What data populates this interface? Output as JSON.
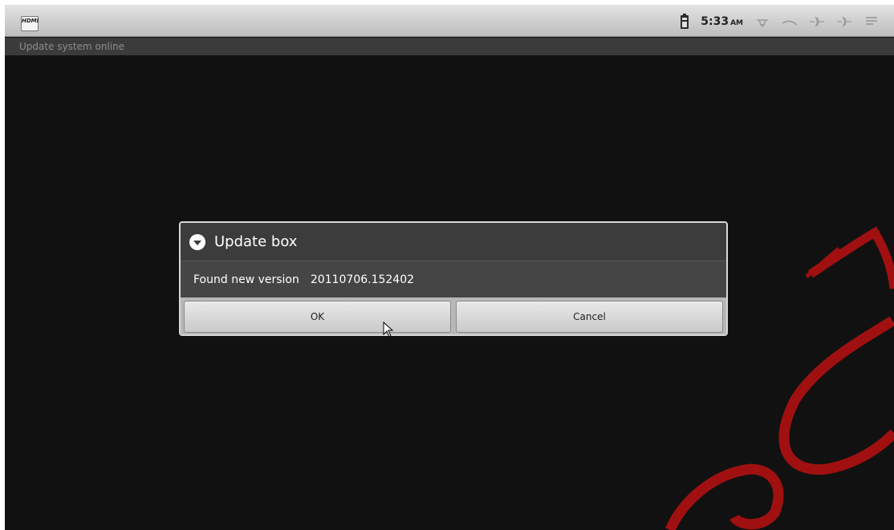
{
  "status_bar": {
    "hdmi_label": "HDMI",
    "time": "5:33",
    "ampm": "AM",
    "icons": [
      "hdmi-icon",
      "battery-icon",
      "usb-icon",
      "signal-icon",
      "data-arrows-icon",
      "data-arrows-icon",
      "notification-icon"
    ]
  },
  "title_bar": {
    "title": "Update system online"
  },
  "dialog": {
    "title": "Update box",
    "icon": "chevron-down-circle-icon",
    "message_label": "Found new version",
    "version": "20110706.152402",
    "ok_label": "OK",
    "cancel_label": "Cancel"
  },
  "colors": {
    "background": "#111111",
    "status_bar": "#d3d3d3",
    "dialog": "#434343",
    "watermark": "#a01010"
  }
}
